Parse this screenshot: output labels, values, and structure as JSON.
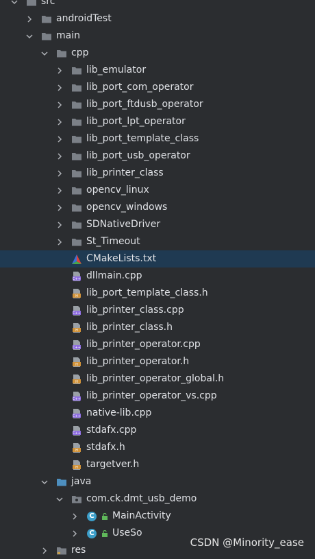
{
  "tree": {
    "src": "src",
    "androidTest": "androidTest",
    "main": "main",
    "cpp": "cpp",
    "folders": [
      "lib_emulator",
      "lib_port_com_operator",
      "lib_port_ftdusb_operator",
      "lib_port_lpt_operator",
      "lib_port_template_class",
      "lib_port_usb_operator",
      "lib_printer_class",
      "opencv_linux",
      "opencv_windows",
      "SDNativeDriver",
      "St_Timeout"
    ],
    "cmake": "CMakeLists.txt",
    "files": [
      {
        "name": "dllmain.cpp",
        "type": "cpp"
      },
      {
        "name": "lib_port_template_class.h",
        "type": "h"
      },
      {
        "name": "lib_printer_class.cpp",
        "type": "cpp"
      },
      {
        "name": "lib_printer_class.h",
        "type": "h"
      },
      {
        "name": "lib_printer_operator.cpp",
        "type": "cpp"
      },
      {
        "name": "lib_printer_operator.h",
        "type": "h"
      },
      {
        "name": "lib_printer_operator_global.h",
        "type": "h"
      },
      {
        "name": "lib_printer_operator_vs.cpp",
        "type": "cpp"
      },
      {
        "name": "native-lib.cpp",
        "type": "cpp"
      },
      {
        "name": "stdafx.cpp",
        "type": "cpp"
      },
      {
        "name": "stdafx.h",
        "type": "h"
      },
      {
        "name": "targetver.h",
        "type": "h"
      }
    ],
    "java": "java",
    "package": "com.ck.dmt_usb_demo",
    "classes": [
      "MainActivity",
      "UseSo"
    ],
    "res": "res"
  },
  "watermark": "CSDN @Minority_ease",
  "colors": {
    "background": "#2b2d30",
    "selected_row": "#1f3a52",
    "folder": "#7b8087",
    "java_folder": "#4d8fbf",
    "text": "#dfe1e5"
  }
}
